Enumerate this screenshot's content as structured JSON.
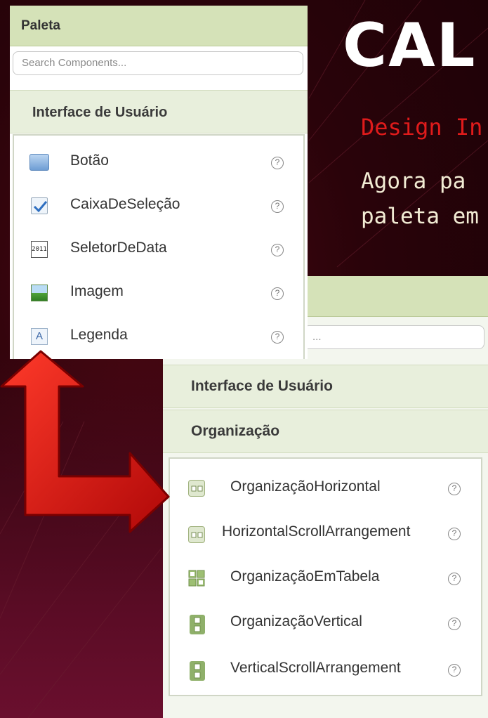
{
  "slide": {
    "title": "CAL",
    "subtitle": "Design In",
    "body_line_1": "Agora pa",
    "body_line_2": "paleta em"
  },
  "palette_top": {
    "header": "Paleta",
    "search_placeholder": "Search Components...",
    "category": "Interface de Usuário",
    "items": [
      {
        "label": "Botão",
        "icon": "button-icon"
      },
      {
        "label": "CaixaDeSeleção",
        "icon": "checkbox-icon"
      },
      {
        "label": "SeletorDeData",
        "icon": "date-picker-icon",
        "icon_text": "2011"
      },
      {
        "label": "Imagem",
        "icon": "image-icon"
      },
      {
        "label": "Legenda",
        "icon": "label-icon",
        "icon_text": "A"
      }
    ],
    "help_glyph": "?"
  },
  "palette_bottom": {
    "search_placeholder": "...",
    "category_1": "Interface de Usuário",
    "category_2": "Organização",
    "items": [
      {
        "label": "OrganizaçãoHorizontal",
        "icon": "horizontal-arrangement-icon"
      },
      {
        "label": "HorizontalScrollArrangement",
        "icon": "horizontal-scroll-arrangement-icon"
      },
      {
        "label": "OrganizaçãoEmTabela",
        "icon": "table-arrangement-icon"
      },
      {
        "label": "OrganizaçãoVertical",
        "icon": "vertical-arrangement-icon"
      },
      {
        "label": "VerticalScrollArrangement",
        "icon": "vertical-scroll-arrangement-icon"
      }
    ],
    "help_glyph": "?"
  },
  "colors": {
    "background": "#2a030a",
    "accent_red": "#e01b1b",
    "palette_header": "#d5e2b8",
    "category_bg": "#e8efdc",
    "arrow_red": "#d00d0d"
  }
}
